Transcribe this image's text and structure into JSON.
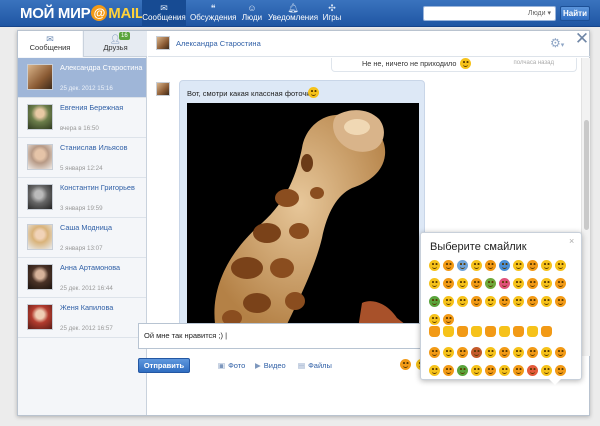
{
  "header": {
    "logo_main": "МОЙ МИР",
    "logo_at": "@",
    "logo_domain": "MAIL.RU",
    "nav": [
      {
        "label": "Сообщения",
        "icon": "envelope-icon",
        "active": true
      },
      {
        "label": "Обсуждения",
        "icon": "comments-icon",
        "active": false
      },
      {
        "label": "Люди",
        "icon": "people-icon",
        "active": false
      },
      {
        "label": "Уведомления",
        "icon": "bell-icon",
        "active": false
      },
      {
        "label": "Игры",
        "icon": "gamepad-icon",
        "active": false
      }
    ],
    "search_placeholder": "",
    "search_scope": "Люди ▾",
    "search_button": "Найти"
  },
  "sidebar": {
    "tabs": [
      {
        "label": "Сообщения",
        "icon": "envelope-icon"
      },
      {
        "label": "Друзья",
        "icon": "friends-icon",
        "badge": "16"
      }
    ],
    "contacts": [
      {
        "name": "Александра Старостина",
        "date": "25 дек. 2012 15:16",
        "selected": true
      },
      {
        "name": "Евгения Бережная",
        "date": "вчера в 16:50",
        "selected": false
      },
      {
        "name": "Станислав Ильясов",
        "date": "5 января 12:24",
        "selected": false
      },
      {
        "name": "Константин Григорьев",
        "date": "3 января 19:59",
        "selected": false
      },
      {
        "name": "Саша Модница",
        "date": "2 января 13:07",
        "selected": false
      },
      {
        "name": "Анна Артамонова",
        "date": "25 дек. 2012 16:44",
        "selected": false
      },
      {
        "name": "Женя Капилова",
        "date": "25 дек. 2012 16:57",
        "selected": false
      }
    ]
  },
  "chat": {
    "contact_name": "Александра Старостина",
    "messages": [
      {
        "text": "Не не, ничего не приходило",
        "time": "полчаса назад",
        "outgoing": true
      },
      {
        "text": "Вот, смотри какая классная фоточка",
        "outgoing": false,
        "has_photo": true
      }
    ]
  },
  "composer": {
    "text": "Ой мне так нравится ;) |",
    "send_label": "Отправить",
    "attachments": [
      {
        "label": "Фото",
        "icon": "photo-icon"
      },
      {
        "label": "Видео",
        "icon": "video-icon"
      },
      {
        "label": "Файлы",
        "icon": "file-icon"
      }
    ]
  },
  "picker": {
    "title": "Выберите смайлик",
    "close": "×"
  },
  "colors": {
    "brand_blue": "#2b64b4",
    "selected_contact": "#9fb6d8",
    "bubble": "#dde8f6",
    "link": "#2f5fa6",
    "emoji_yellow": "#f6c21a",
    "emoji_orange": "#f29a16",
    "friends_badge": "#5aa43c"
  }
}
